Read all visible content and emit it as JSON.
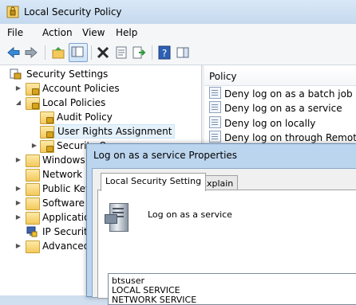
{
  "window": {
    "title": "Local Security Policy"
  },
  "menu": [
    "File",
    "Action",
    "View",
    "Help"
  ],
  "tree": {
    "root": "Security Settings",
    "items": [
      {
        "label": "Account Policies"
      },
      {
        "label": "Local Policies"
      },
      {
        "label": "Audit Policy"
      },
      {
        "label": "User Rights Assignment"
      },
      {
        "label": "Security O"
      },
      {
        "label": "Windows"
      },
      {
        "label": "Network L"
      },
      {
        "label": "Public Key"
      },
      {
        "label": "Software R"
      },
      {
        "label": "Application"
      },
      {
        "label": "IP Security"
      },
      {
        "label": "Advanced"
      }
    ]
  },
  "policy_pane": {
    "header": "Policy",
    "rows": [
      "Deny log on as a batch job",
      "Deny log on as a service",
      "Deny log on locally",
      "Deny log on through Remote D"
    ]
  },
  "dialog": {
    "title": "Log on as a service Properties",
    "tabs": [
      "Local Security Setting",
      "Explain"
    ],
    "setting_name": "Log on as a service",
    "accounts": [
      "btsuser",
      "LOCAL SERVICE",
      "NETWORK SERVICE"
    ]
  },
  "colors": {
    "folder": "#f3c95c",
    "selection": "#e5f1fb",
    "dialog_frame": "#bcd5ee"
  }
}
